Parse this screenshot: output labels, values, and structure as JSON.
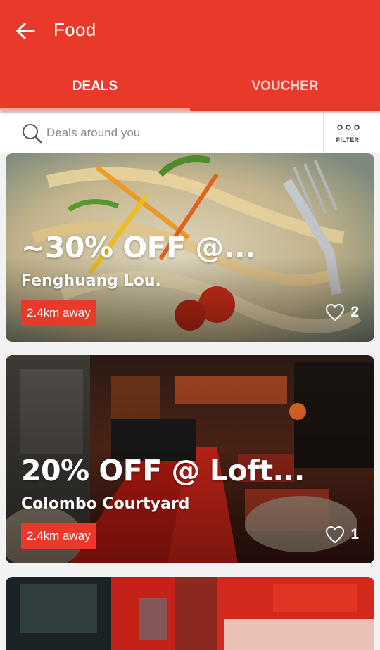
{
  "header": {
    "title": "Food"
  },
  "tabs": [
    {
      "label": "DEALS",
      "active": true
    },
    {
      "label": "VOUCHER",
      "active": false
    }
  ],
  "search": {
    "placeholder": "Deals around you",
    "value": ""
  },
  "filter": {
    "label": "FILTER"
  },
  "colors": {
    "accent": "#e8392a",
    "tab_indicator": "#f4a9a1"
  },
  "deals": [
    {
      "headline": "~30% OFF @...",
      "place": "Fenghuang Lou.",
      "distance": "2.4km away",
      "likes": "2"
    },
    {
      "headline": "20% OFF @ Loft...",
      "place": "Colombo Courtyard",
      "distance": "2.4km away",
      "likes": "1"
    },
    {
      "headline": "",
      "place": "",
      "distance": "",
      "likes": ""
    }
  ]
}
